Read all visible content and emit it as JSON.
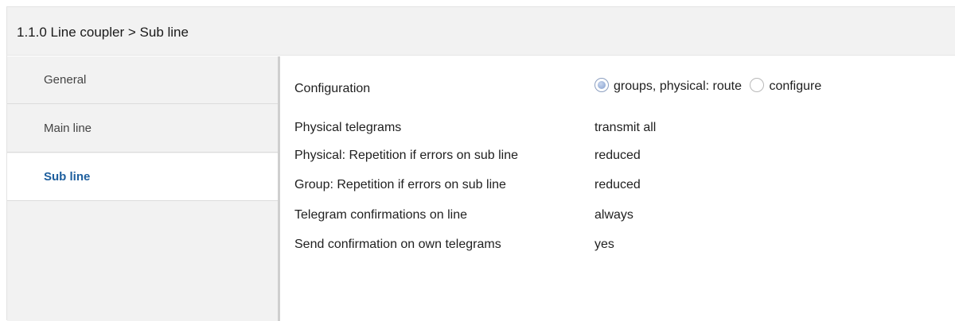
{
  "header": {
    "title": "1.1.0 Line coupler > Sub line"
  },
  "sidebar": {
    "items": [
      {
        "label": "General",
        "active": false
      },
      {
        "label": "Main line",
        "active": false
      },
      {
        "label": "Sub line",
        "active": true
      }
    ]
  },
  "parameters": {
    "configuration": {
      "label": "Configuration",
      "options": [
        {
          "label": "groups, physical: route",
          "selected": true
        },
        {
          "label": "configure",
          "selected": false
        }
      ]
    },
    "rows": [
      {
        "label": "Physical telegrams",
        "value": "transmit all"
      },
      {
        "label": "Physical: Repetition if errors on sub line",
        "value": "reduced"
      },
      {
        "label": "Group: Repetition if errors on sub line",
        "value": "reduced"
      },
      {
        "label": "Telegram confirmations on line",
        "value": "always"
      },
      {
        "label": "Send confirmation on own telegrams",
        "value": "yes"
      }
    ]
  },
  "colors": {
    "active_nav_text": "#1e5f9e",
    "sidebar_background": "#f2f2f2",
    "radio_selected": "#9fb5db"
  }
}
